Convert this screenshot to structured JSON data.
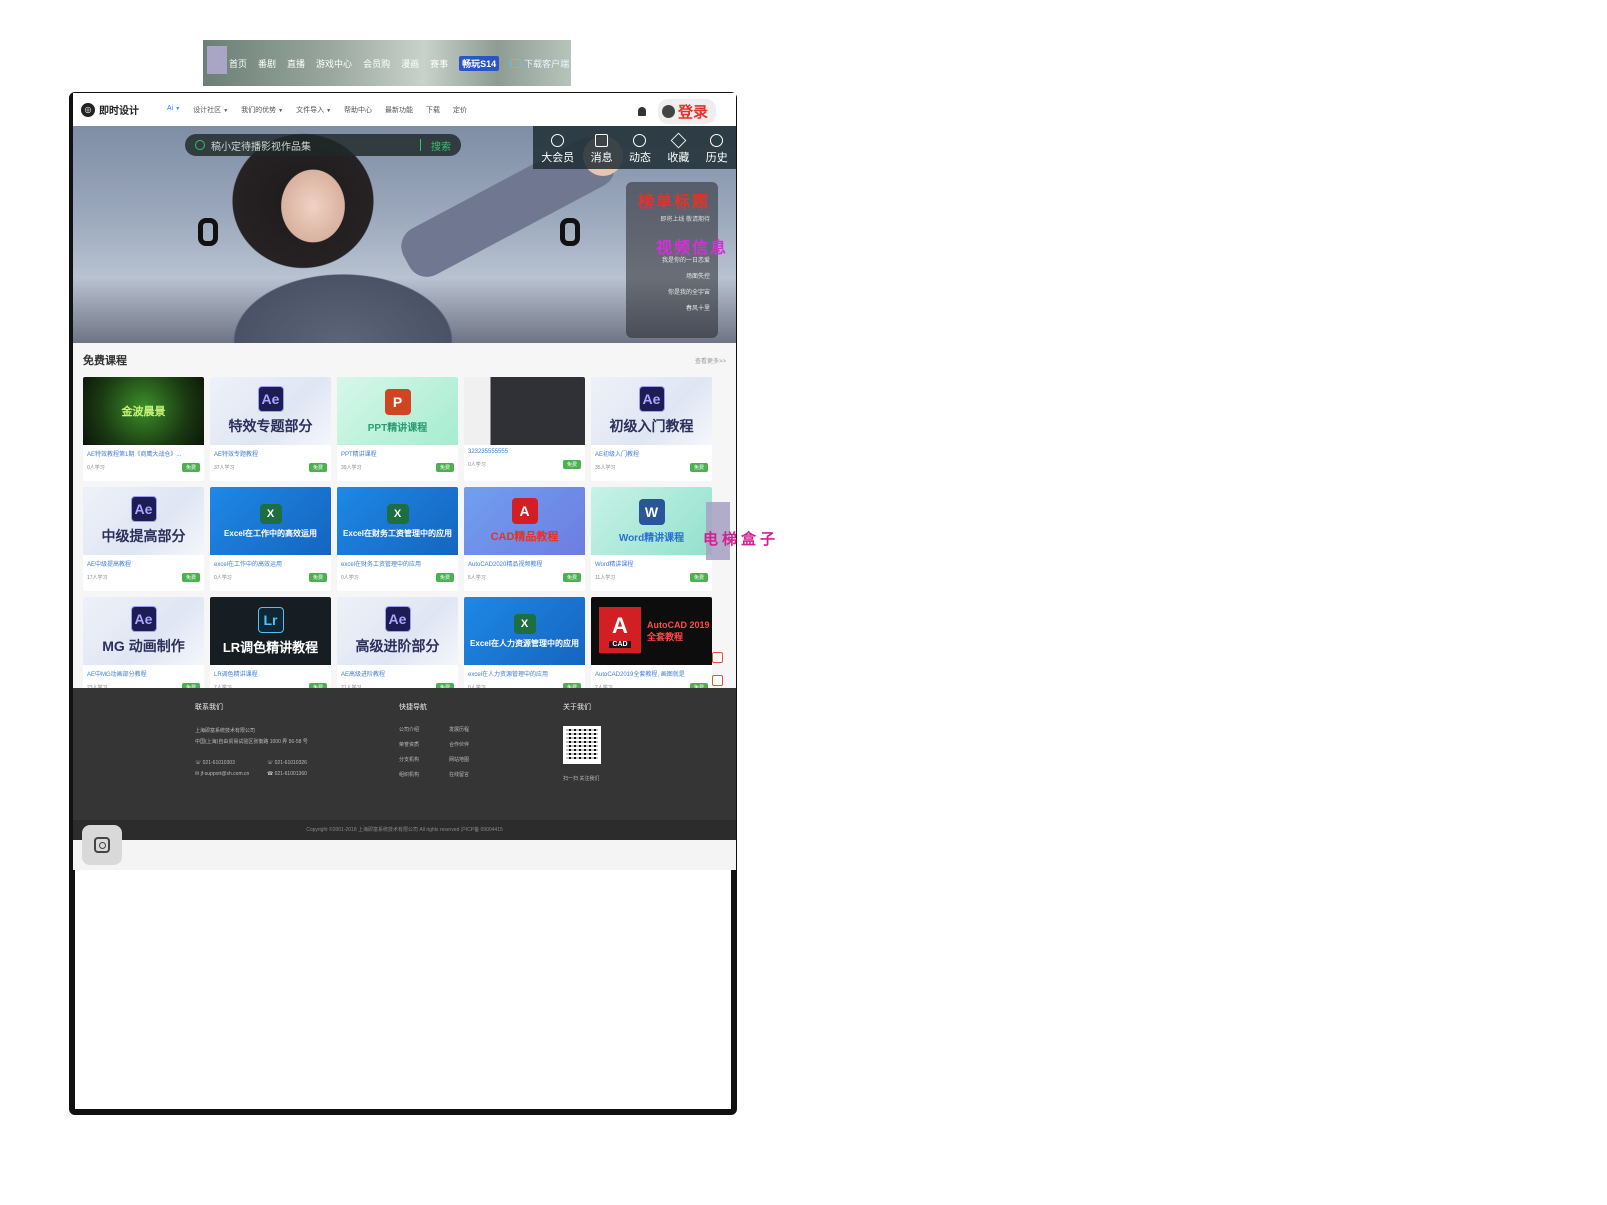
{
  "top_strip": {
    "items": [
      "首页",
      "番剧",
      "直播",
      "游戏中心",
      "会员购",
      "漫画",
      "赛事"
    ],
    "highlight": "畅玩S14",
    "download": "下载客户端"
  },
  "header": {
    "brand": "即时设计",
    "nav": [
      "Ai",
      "设计社区",
      "我们的优势",
      "文件导入",
      "帮助中心",
      "最新功能",
      "下载",
      "定价"
    ],
    "login": "登录"
  },
  "banner": {
    "search_placeholder": "稿小定待播影视作品集",
    "search_button": "搜索",
    "quick_icons": [
      "大会员",
      "消息",
      "动态",
      "收藏",
      "历史"
    ],
    "side_panel": {
      "title": "榜单标题",
      "subtitle": "即将上线 敬请期待",
      "overlay": "视频信息",
      "list": [
        "我是你的一日恋爱",
        "场面失控",
        "你是我的全宇宙",
        "春风十里"
      ]
    }
  },
  "courses": {
    "title": "免费课程",
    "more": "查看更多>>",
    "free_tag": "免费",
    "items": [
      {
        "thumb": "金波晨景",
        "title": "AE特效教程第1期《商鹰大战仓》...",
        "meta": "0人学习"
      },
      {
        "thumb": "特效专题部分",
        "title": "AE特效专题教程",
        "meta": "37人学习"
      },
      {
        "thumb": "PPT精讲课程",
        "title": "PPT精讲课程",
        "meta": "39人学习"
      },
      {
        "thumb": "",
        "title": "323235555555",
        "meta": "0人学习"
      },
      {
        "thumb": "初级入门教程",
        "title": "AE初级入门教程",
        "meta": "35人学习"
      },
      {
        "thumb": "中级提高部分",
        "title": "AE中级提高教程",
        "meta": "17人学习"
      },
      {
        "thumb": "Excel在工作中的高效运用",
        "title": "excel在工作中的高效运用",
        "meta": "0人学习"
      },
      {
        "thumb": "Excel在财务工资管理中的应用",
        "title": "excel在财务工资管理中的应用",
        "meta": "0人学习"
      },
      {
        "thumb": "CAD精品教程",
        "title": "AutoCAD2020精品视频教程",
        "meta": "5人学习"
      },
      {
        "thumb": "Word精讲课程",
        "title": "Word精讲课程",
        "meta": "11人学习"
      },
      {
        "thumb": "MG 动画制作",
        "title": "AE中MG动画部分教程",
        "meta": "23人学习"
      },
      {
        "thumb": "LR调色精讲教程",
        "title": "LR调色精讲课程",
        "meta": "7人学习"
      },
      {
        "thumb": "高级进阶部分",
        "title": "AE高级进阶教程",
        "meta": "21人学习"
      },
      {
        "thumb": "Excel在人力资源管理中的应用",
        "title": "excel在人力资源管理中的应用",
        "meta": "0人学习"
      },
      {
        "thumb": "AutoCAD 2019全套教程",
        "title": "AutoCAD2019全套教程, 画图就是",
        "meta": "2人学习"
      }
    ],
    "elevator": "电梯盒子"
  },
  "footer": {
    "contact_title": "联系我们",
    "contact_lines": [
      "上海即富系统技术有限公司",
      "中国(上海)自由贸易试验区张衡路 1000 弄 56-58 号"
    ],
    "phones": [
      "021-61010303",
      "021-61010326",
      "jf-support@sh.com.cn",
      "021-61001360"
    ],
    "nav_title": "快捷导航",
    "nav_links": [
      "公司介绍",
      "发展历程",
      "荣誉资质",
      "合作伙伴",
      "分支机构",
      "网站地图",
      "组织机构",
      "在线留言"
    ],
    "about_title": "关于我们",
    "qr_caption": "扫一扫 关注我们",
    "copyright": "Copyright ©2001-2018 上海即富系统技术有限公司 All rights reserved 沪ICP备 09004415"
  },
  "colors": {
    "accent_green": "#36c26b",
    "login_red": "#e4322a",
    "overlay_magenta": "#d430d8",
    "elevator_pink": "#d41f92"
  }
}
